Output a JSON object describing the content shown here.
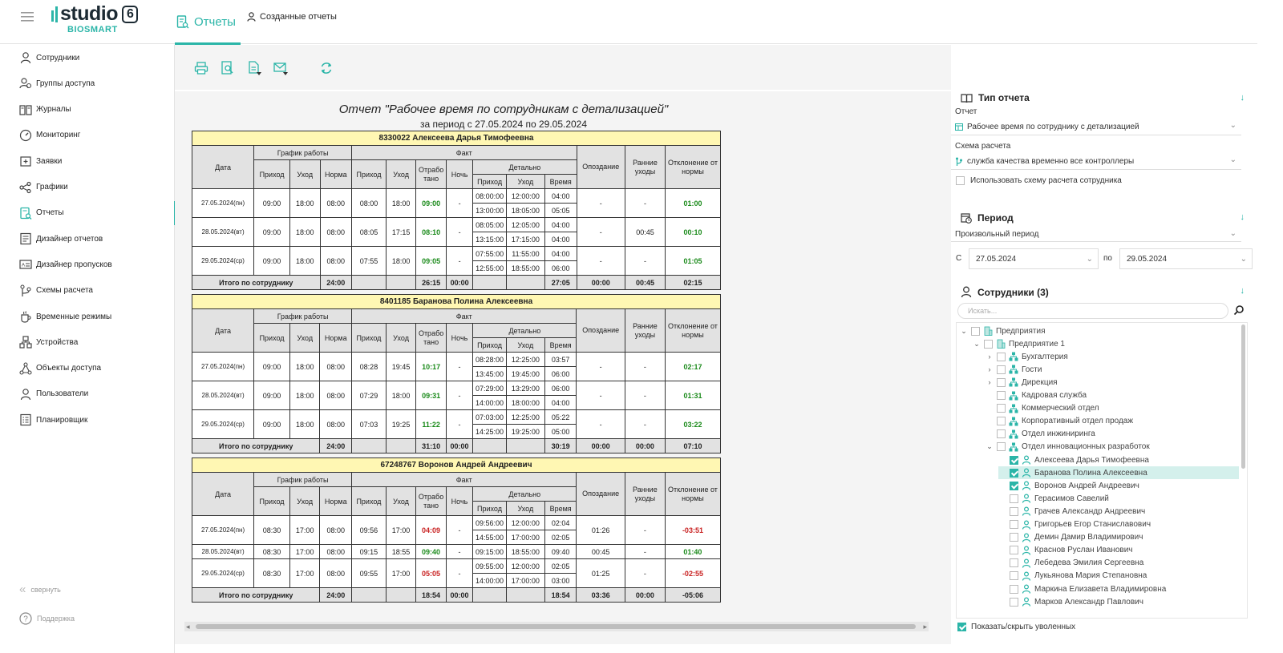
{
  "header": {
    "logo_text": "studio",
    "logo_version": "6",
    "logo_sub": "BIOSMART",
    "tab_reports": "Отчеты",
    "tab_created": "Созданные отчеты"
  },
  "sidebar": {
    "items": [
      {
        "label": "Сотрудники",
        "icon": "person-icon"
      },
      {
        "label": "Группы доступа",
        "icon": "group-icon"
      },
      {
        "label": "Журналы",
        "icon": "journal-icon"
      },
      {
        "label": "Мониторинг",
        "icon": "gauge-icon"
      },
      {
        "label": "Заявки",
        "icon": "request-icon"
      },
      {
        "label": "Графики",
        "icon": "schedule-icon"
      },
      {
        "label": "Отчеты",
        "icon": "report-icon",
        "active": true
      },
      {
        "label": "Дизайнер отчетов",
        "icon": "report-designer-icon"
      },
      {
        "label": "Дизайнер пропусков",
        "icon": "pass-designer-icon"
      },
      {
        "label": "Схемы расчета",
        "icon": "calc-scheme-icon"
      },
      {
        "label": "Временные режимы",
        "icon": "time-mode-icon"
      },
      {
        "label": "Устройства",
        "icon": "device-icon"
      },
      {
        "label": "Объекты доступа",
        "icon": "access-object-icon"
      },
      {
        "label": "Пользователи",
        "icon": "user-icon"
      },
      {
        "label": "Планировщик",
        "icon": "planner-icon"
      }
    ],
    "collapse_label": "свернуть",
    "support_label": "Поддержка"
  },
  "toolbar": [
    "print-icon",
    "preview-icon",
    "export-icon",
    "email-icon",
    "refresh-icon"
  ],
  "report": {
    "title": "Отчет \"Рабочее время по сотрудникам с детализацией\"",
    "period": "за период с 27.05.2024 по 29.05.2024",
    "headers": {
      "date": "Дата",
      "schedule": "График работы",
      "fact": "Факт",
      "in": "Приход",
      "out": "Уход",
      "norm": "Норма",
      "worked": "Отрабо тано",
      "night": "Ночь",
      "detail": "Детально",
      "time": "Время",
      "late": "Опоздание",
      "early": "Ранние уходы",
      "deviation": "Отклонение от нормы",
      "total_label": "Итого по сотруднику"
    },
    "employees": [
      {
        "name": "8330022 Алексеева Дарья Тимофеевна",
        "days": [
          {
            "date": "27.05.2024(пн)",
            "s_in": "09:00",
            "s_out": "18:00",
            "norm": "08:00",
            "f_in": "08:00",
            "f_out": "18:00",
            "worked": "09:00",
            "worked_color": "green",
            "night": "-",
            "details": [
              [
                "08:00:00",
                "12:00:00",
                "04:00"
              ],
              [
                "13:00:00",
                "18:05:00",
                "05:05"
              ]
            ],
            "late": "-",
            "early": "-",
            "dev": "01:00",
            "dev_color": "green"
          },
          {
            "date": "28.05.2024(вт)",
            "s_in": "09:00",
            "s_out": "18:00",
            "norm": "08:00",
            "f_in": "08:05",
            "f_out": "17:15",
            "worked": "08:10",
            "worked_color": "green",
            "night": "-",
            "details": [
              [
                "08:05:00",
                "12:05:00",
                "04:00"
              ],
              [
                "13:15:00",
                "17:15:00",
                "04:00"
              ]
            ],
            "late": "-",
            "early": "00:45",
            "dev": "00:10",
            "dev_color": "green"
          },
          {
            "date": "29.05.2024(ср)",
            "s_in": "09:00",
            "s_out": "18:00",
            "norm": "08:00",
            "f_in": "07:55",
            "f_out": "18:00",
            "worked": "09:05",
            "worked_color": "green",
            "night": "-",
            "details": [
              [
                "07:55:00",
                "11:55:00",
                "04:00"
              ],
              [
                "12:55:00",
                "18:55:00",
                "06:00"
              ]
            ],
            "late": "-",
            "early": "-",
            "dev": "01:05",
            "dev_color": "green"
          }
        ],
        "total": {
          "norm": "24:00",
          "worked": "26:15",
          "night": "00:00",
          "time": "27:05",
          "late": "00:00",
          "early": "00:45",
          "dev": "02:15"
        }
      },
      {
        "name": "8401185 Баранова Полина Алексеевна",
        "days": [
          {
            "date": "27.05.2024(пн)",
            "s_in": "09:00",
            "s_out": "18:00",
            "norm": "08:00",
            "f_in": "08:28",
            "f_out": "19:45",
            "worked": "10:17",
            "worked_color": "green",
            "night": "-",
            "details": [
              [
                "08:28:00",
                "12:25:00",
                "03:57"
              ],
              [
                "13:45:00",
                "19:45:00",
                "06:00"
              ]
            ],
            "late": "-",
            "early": "-",
            "dev": "02:17",
            "dev_color": "green"
          },
          {
            "date": "28.05.2024(вт)",
            "s_in": "09:00",
            "s_out": "18:00",
            "norm": "08:00",
            "f_in": "07:29",
            "f_out": "18:00",
            "worked": "09:31",
            "worked_color": "green",
            "night": "-",
            "details": [
              [
                "07:29:00",
                "13:29:00",
                "06:00"
              ],
              [
                "14:00:00",
                "18:00:00",
                "04:00"
              ]
            ],
            "late": "-",
            "early": "-",
            "dev": "01:31",
            "dev_color": "green"
          },
          {
            "date": "29.05.2024(ср)",
            "s_in": "09:00",
            "s_out": "18:00",
            "norm": "08:00",
            "f_in": "07:03",
            "f_out": "19:25",
            "worked": "11:22",
            "worked_color": "green",
            "night": "-",
            "details": [
              [
                "07:03:00",
                "12:25:00",
                "05:22"
              ],
              [
                "14:25:00",
                "19:25:00",
                "05:00"
              ]
            ],
            "late": "-",
            "early": "-",
            "dev": "03:22",
            "dev_color": "green"
          }
        ],
        "total": {
          "norm": "24:00",
          "worked": "31:10",
          "night": "00:00",
          "time": "30:19",
          "late": "00:00",
          "early": "00:00",
          "dev": "07:10"
        }
      },
      {
        "name": "67248767 Воронов Андрей Андреевич",
        "days": [
          {
            "date": "27.05.2024(пн)",
            "s_in": "08:30",
            "s_out": "17:00",
            "norm": "08:00",
            "f_in": "09:56",
            "f_out": "17:00",
            "worked": "04:09",
            "worked_color": "red",
            "night": "-",
            "details": [
              [
                "09:56:00",
                "12:00:00",
                "02:04"
              ],
              [
                "14:55:00",
                "17:00:00",
                "02:05"
              ]
            ],
            "late": "01:26",
            "early": "-",
            "dev": "-03:51",
            "dev_color": "red"
          },
          {
            "date": "28.05.2024(вт)",
            "s_in": "08:30",
            "s_out": "17:00",
            "norm": "08:00",
            "f_in": "09:15",
            "f_out": "18:55",
            "worked": "09:40",
            "worked_color": "green",
            "night": "-",
            "details": [
              [
                "09:15:00",
                "18:55:00",
                "09:40"
              ]
            ],
            "late": "00:45",
            "early": "-",
            "dev": "01:40",
            "dev_color": "green"
          },
          {
            "date": "29.05.2024(ср)",
            "s_in": "08:30",
            "s_out": "17:00",
            "norm": "08:00",
            "f_in": "09:55",
            "f_out": "17:00",
            "worked": "05:05",
            "worked_color": "red",
            "night": "-",
            "details": [
              [
                "09:55:00",
                "12:00:00",
                "02:05"
              ],
              [
                "14:00:00",
                "17:00:00",
                "03:00"
              ]
            ],
            "late": "01:25",
            "early": "-",
            "dev": "-02:55",
            "dev_color": "red"
          }
        ],
        "total": {
          "norm": "24:00",
          "worked": "18:54",
          "night": "00:00",
          "time": "18:54",
          "late": "03:36",
          "early": "00:00",
          "dev": "-05:06"
        }
      }
    ]
  },
  "panel": {
    "report_type": {
      "title": "Тип отчета",
      "report_label": "Отчет",
      "report_value": "Рабочее время по сотруднику с детализацией",
      "scheme_label": "Схема расчета",
      "scheme_value": "служба качества временно все контроллеры",
      "use_scheme_label": "Использовать схему расчета сотрудника"
    },
    "period": {
      "title": "Период",
      "mode": "Произвольный период",
      "from_label": "С",
      "from": "27.05.2024",
      "to_label": "по",
      "to": "29.05.2024"
    },
    "employees": {
      "title": "Сотрудники (3)",
      "search_placeholder": "Искать...",
      "tree": [
        {
          "label": "Предприятия",
          "level": 0,
          "toggle": "⌄",
          "type": "org",
          "checked": false
        },
        {
          "label": "Предприятие 1",
          "level": 1,
          "toggle": "⌄",
          "type": "org",
          "checked": false
        },
        {
          "label": "Бухгалтерия",
          "level": 2,
          "toggle": "›",
          "type": "dept",
          "checked": false
        },
        {
          "label": "Гости",
          "level": 2,
          "toggle": "›",
          "type": "dept",
          "checked": false
        },
        {
          "label": "Дирекция",
          "level": 2,
          "toggle": "›",
          "type": "dept",
          "checked": false
        },
        {
          "label": "Кадровая служба",
          "level": 2,
          "toggle": "",
          "type": "dept",
          "checked": false
        },
        {
          "label": "Коммерческий отдел",
          "level": 2,
          "toggle": "",
          "type": "dept",
          "checked": false
        },
        {
          "label": "Корпоративный отдел продаж",
          "level": 2,
          "toggle": "",
          "type": "dept",
          "checked": false
        },
        {
          "label": "Отдел инжиниринга",
          "level": 2,
          "toggle": "",
          "type": "dept",
          "checked": false
        },
        {
          "label": "Отдел инновационных разработок",
          "level": 2,
          "toggle": "⌄",
          "type": "dept",
          "checked": false
        },
        {
          "label": "Алексеева Дарья Тимофеевна",
          "level": 3,
          "toggle": "",
          "type": "person",
          "checked": true
        },
        {
          "label": "Баранова Полина Алексеевна",
          "level": 3,
          "toggle": "",
          "type": "person",
          "checked": true,
          "highlight": true
        },
        {
          "label": "Воронов Андрей Андреевич",
          "level": 3,
          "toggle": "",
          "type": "person",
          "checked": true
        },
        {
          "label": "Герасимов Савелий",
          "level": 3,
          "toggle": "",
          "type": "person",
          "checked": false
        },
        {
          "label": "Грачев Александр Андреевич",
          "level": 3,
          "toggle": "",
          "type": "person",
          "checked": false
        },
        {
          "label": "Григорьев Егор Станиславович",
          "level": 3,
          "toggle": "",
          "type": "person",
          "checked": false
        },
        {
          "label": "Демин Дамир Владимирович",
          "level": 3,
          "toggle": "",
          "type": "person",
          "checked": false
        },
        {
          "label": "Краснов Руслан Иванович",
          "level": 3,
          "toggle": "",
          "type": "person",
          "checked": false
        },
        {
          "label": "Лебедева Эмилия Сергеевна",
          "level": 3,
          "toggle": "",
          "type": "person",
          "checked": false
        },
        {
          "label": "Лукьянова Мария Степановна",
          "level": 3,
          "toggle": "",
          "type": "person",
          "checked": false
        },
        {
          "label": "Маркина Елизавета Владимировна",
          "level": 3,
          "toggle": "",
          "type": "person",
          "checked": false
        },
        {
          "label": "Марков Александр Павлович",
          "level": 3,
          "toggle": "",
          "type": "person",
          "checked": false
        }
      ],
      "show_fired_label": "Показать/скрыть уволенных"
    }
  },
  "colors": {
    "accent": "#2bb5a8",
    "good": "#1a8a1a",
    "bad": "#c82020",
    "emp_header": "#fff7b3"
  }
}
